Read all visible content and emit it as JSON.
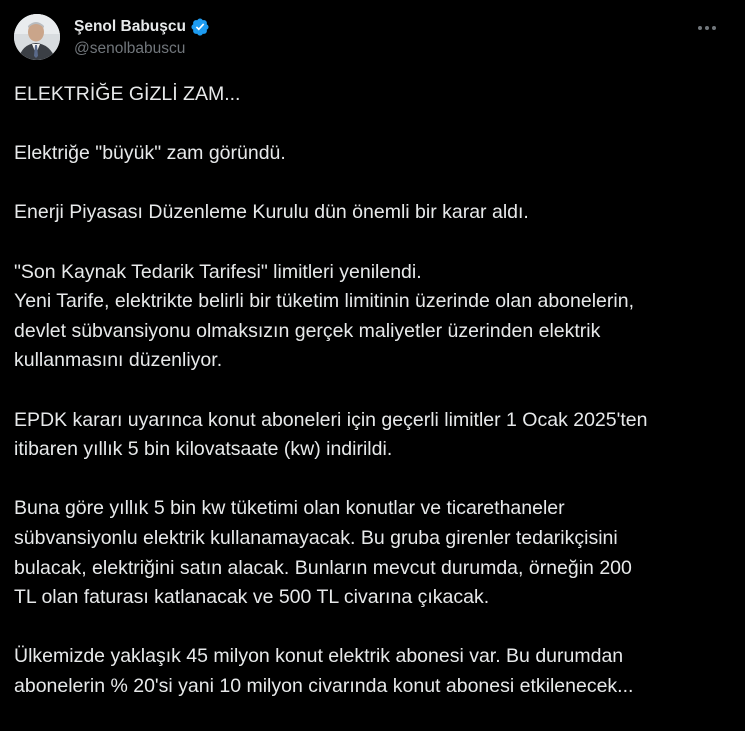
{
  "author": {
    "display_name": "Şenol Babuşcu",
    "handle": "@senolbabuscu",
    "verified_badge_color": "#1d9bf0"
  },
  "icons": {
    "verified": "verified-badge-icon",
    "more": "more-options-icon"
  },
  "colors": {
    "background": "#000000",
    "text": "#e7e9ea",
    "secondary_text": "#71767b"
  },
  "paragraphs": [
    {
      "lines": [
        "ELEKTRİĞE GİZLİ ZAM..."
      ]
    },
    {
      "lines": [
        "Elektriğe \"büyük\" zam göründü."
      ]
    },
    {
      "lines": [
        "Enerji Piyasası Düzenleme Kurulu dün önemli bir karar aldı."
      ]
    },
    {
      "lines": [
        "\"Son Kaynak Tedarik Tarifesi\" limitleri yenilendi.",
        "Yeni Tarife, elektrikte belirli bir tüketim limitinin üzerinde olan abonelerin,",
        "devlet sübvansiyonu olmaksızın gerçek maliyetler üzerinden elektrik",
        "kullanmasını düzenliyor."
      ]
    },
    {
      "lines": [
        "EPDK kararı uyarınca konut aboneleri için geçerli limitler 1 Ocak 2025'ten",
        "itibaren yıllık 5 bin kilovatsaate (kw) indirildi."
      ]
    },
    {
      "lines": [
        "Buna göre yıllık 5 bin kw tüketimi olan konutlar ve ticarethaneler",
        "sübvansiyonlu elektrik kullanamayacak. Bu gruba girenler tedarikçisini",
        "bulacak, elektriğini satın alacak. Bunların mevcut durumda, örneğin 200",
        "TL olan faturası katlanacak ve 500 TL civarına çıkacak."
      ]
    },
    {
      "lines": [
        "Ülkemizde yaklaşık 45 milyon konut elektrik abonesi var. Bu durumdan",
        "abonelerin % 20'si yani  10 milyon civarında konut abonesi etkilenecek..."
      ]
    }
  ]
}
